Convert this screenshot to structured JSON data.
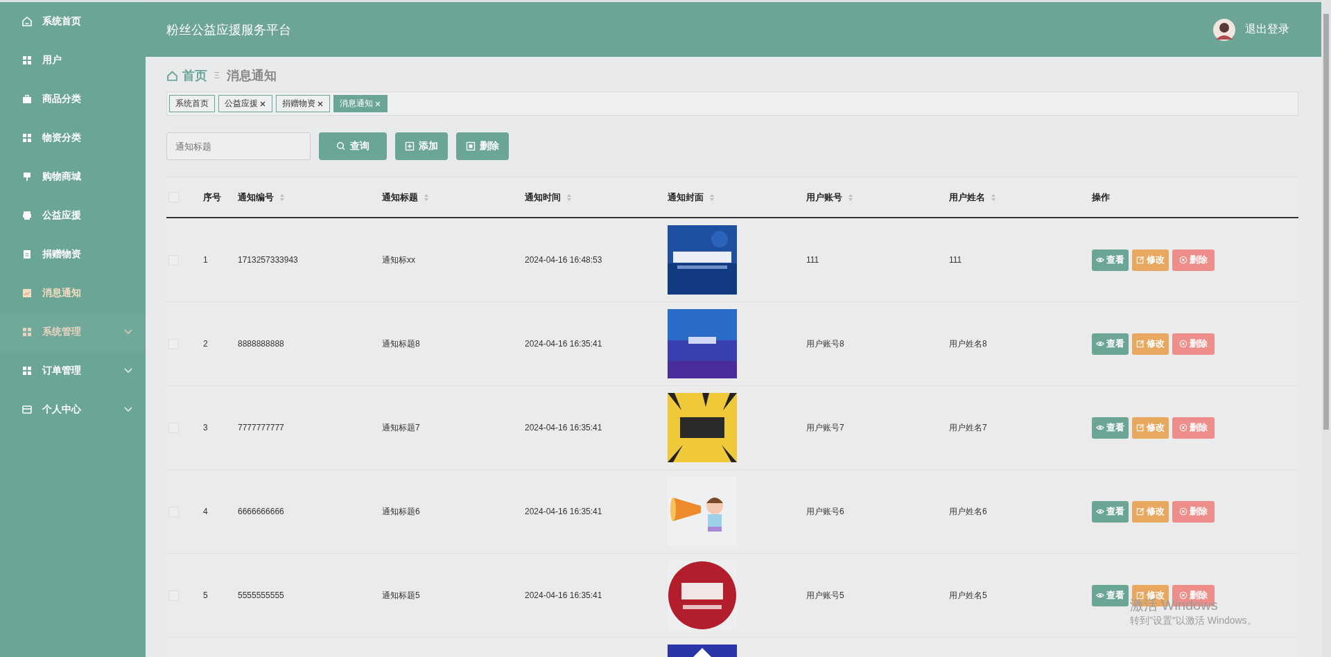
{
  "sidebar": {
    "items": [
      {
        "label": "系统首页",
        "selected": false,
        "hovered": false
      },
      {
        "label": "用户",
        "selected": false,
        "hovered": false
      },
      {
        "label": "商品分类",
        "selected": false,
        "hovered": false
      },
      {
        "label": "物资分类",
        "selected": false,
        "hovered": false
      },
      {
        "label": "购物商城",
        "selected": false,
        "hovered": false
      },
      {
        "label": "公益应援",
        "selected": false,
        "hovered": false
      },
      {
        "label": "捐赠物资",
        "selected": false,
        "hovered": false
      },
      {
        "label": "消息通知",
        "selected": true,
        "hovered": false
      },
      {
        "label": "系统管理",
        "selected": false,
        "hovered": true,
        "expanded": false
      },
      {
        "label": "订单管理",
        "selected": false,
        "hovered": false,
        "expanded": false
      },
      {
        "label": "个人中心",
        "selected": false,
        "hovered": false,
        "expanded": false
      }
    ]
  },
  "header": {
    "title": "粉丝公益应援服务平台",
    "logout": "退出登录"
  },
  "breadcrumb": {
    "home": "首页",
    "separator": "Ξ",
    "current": "消息通知"
  },
  "tabs": [
    {
      "label": "系统首页",
      "selected": false,
      "closable": false
    },
    {
      "label": "公益应援",
      "selected": false,
      "closable": true
    },
    {
      "label": "捐赠物资",
      "selected": false,
      "closable": true
    },
    {
      "label": "消息通知",
      "selected": true,
      "closable": true
    }
  ],
  "toolbar": {
    "search": {
      "placeholder": "通知标题"
    },
    "query": "查询",
    "add": "添加",
    "delete": "删除"
  },
  "table": {
    "select_all_checked": false,
    "columns": [
      {
        "label": "序号",
        "sortable": false
      },
      {
        "label": "通知编号",
        "sortable": true
      },
      {
        "label": "通知标题",
        "sortable": true
      },
      {
        "label": "通知时间",
        "sortable": true
      },
      {
        "label": "通知封面",
        "sortable": true
      },
      {
        "label": "用户账号",
        "sortable": true
      },
      {
        "label": "用户姓名",
        "sortable": true
      },
      {
        "label": "操作",
        "sortable": false
      }
    ],
    "rows": [
      {
        "checked": false,
        "index": "1",
        "number": "1713257333943",
        "title": "通知标xx",
        "time": "2024-04-16 16:48:53",
        "cover": {
          "kind": "picture"
        },
        "account": "111",
        "name": "111",
        "actions": [
          "查看",
          "修改",
          "删除"
        ]
      },
      {
        "checked": false,
        "index": "2",
        "number": "8888888888",
        "title": "通知标题8",
        "time": "2024-04-16 16:35:41",
        "cover": {
          "kind": "picture"
        },
        "account": "用户账号8",
        "name": "用户姓名8",
        "actions": [
          "查看",
          "修改",
          "删除"
        ]
      },
      {
        "checked": false,
        "index": "3",
        "number": "7777777777",
        "title": "通知标题7",
        "time": "2024-04-16 16:35:41",
        "cover": {
          "kind": "picture"
        },
        "account": "用户账号7",
        "name": "用户姓名7",
        "actions": [
          "查看",
          "修改",
          "删除"
        ]
      },
      {
        "checked": false,
        "index": "4",
        "number": "6666666666",
        "title": "通知标题6",
        "time": "2024-04-16 16:35:41",
        "cover": {
          "kind": "picture"
        },
        "account": "用户账号6",
        "name": "用户姓名6",
        "actions": [
          "查看",
          "修改",
          "删除"
        ]
      },
      {
        "checked": false,
        "index": "5",
        "number": "5555555555",
        "title": "通知标题5",
        "time": "2024-04-16 16:35:41",
        "cover": {
          "kind": "picture"
        },
        "account": "用户账号5",
        "name": "用户姓名5",
        "actions": [
          "查看",
          "修改",
          "删除"
        ]
      },
      {
        "cover": {
          "kind": "picture"
        }
      }
    ]
  },
  "os_notice": {
    "title": "激活 Windows",
    "subtitle": "转到\"设置\"以激活 Windows。"
  }
}
